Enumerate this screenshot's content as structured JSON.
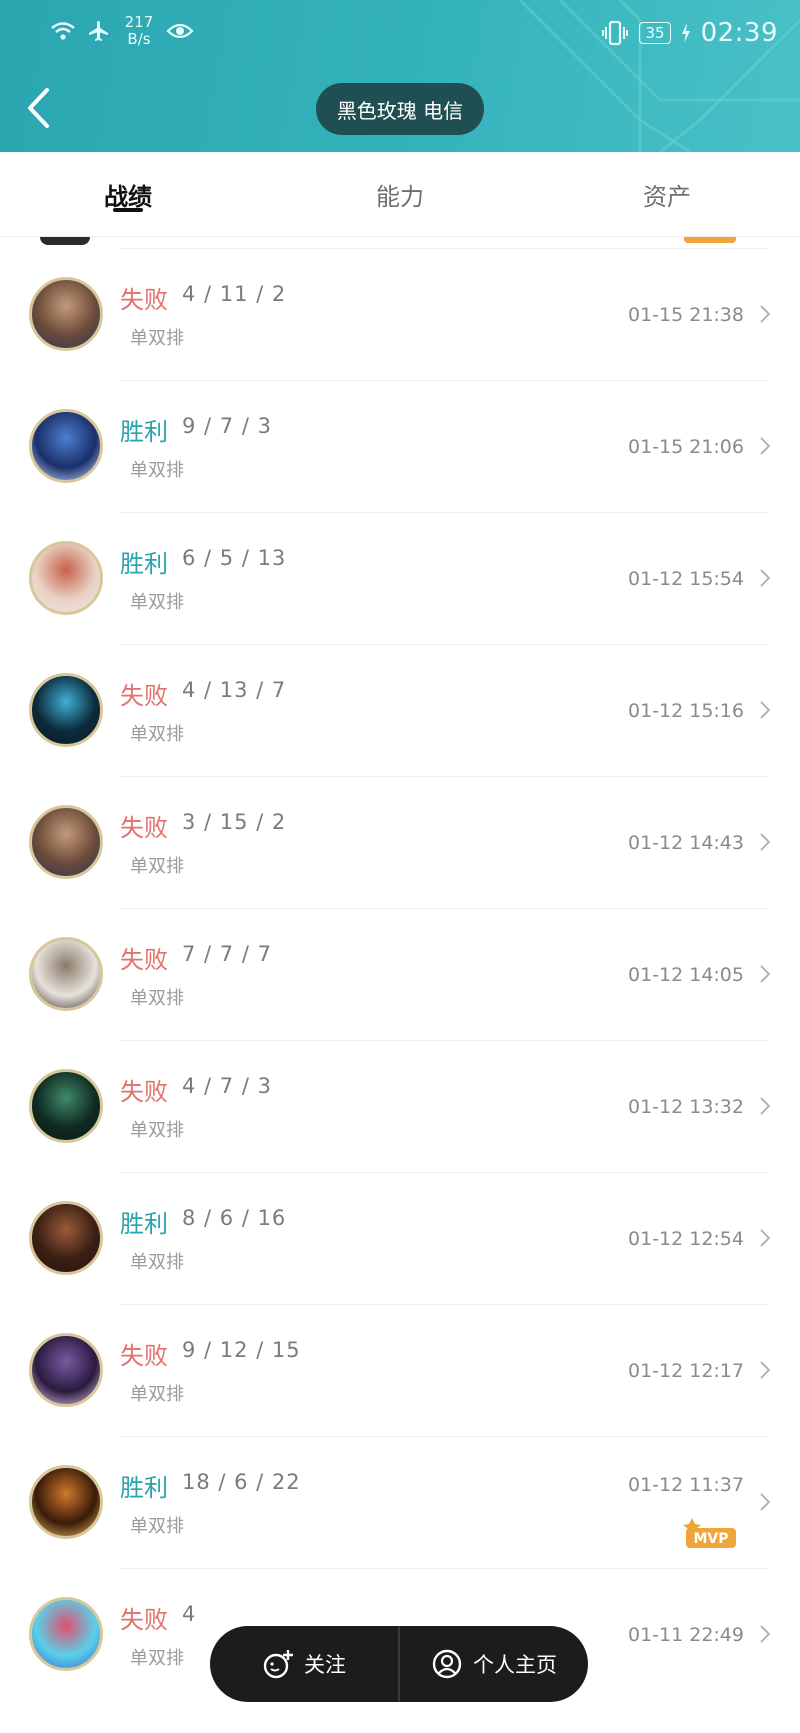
{
  "status_bar": {
    "speed_value": "217",
    "speed_unit": "B/s",
    "battery": "35",
    "time": "02:39"
  },
  "header": {
    "title": "黑色玫瑰 电信"
  },
  "tabs": [
    {
      "label": "战绩",
      "active": true
    },
    {
      "label": "能力",
      "active": false
    },
    {
      "label": "资产",
      "active": false
    }
  ],
  "matches": [
    {
      "result": "失败",
      "outcome": "lose",
      "kda": "4 / 11 / 2",
      "mode": "单双排",
      "time": "01-15 21:38",
      "mvp": false,
      "champion_icon": "champion-avatar-1"
    },
    {
      "result": "胜利",
      "outcome": "win",
      "kda": "9 / 7 / 3",
      "mode": "单双排",
      "time": "01-15 21:06",
      "mvp": false,
      "champion_icon": "champion-avatar-2"
    },
    {
      "result": "胜利",
      "outcome": "win",
      "kda": "6 / 5 / 13",
      "mode": "单双排",
      "time": "01-12 15:54",
      "mvp": false,
      "champion_icon": "champion-avatar-3"
    },
    {
      "result": "失败",
      "outcome": "lose",
      "kda": "4 / 13 / 7",
      "mode": "单双排",
      "time": "01-12 15:16",
      "mvp": false,
      "champion_icon": "champion-avatar-4"
    },
    {
      "result": "失败",
      "outcome": "lose",
      "kda": "3 / 15 / 2",
      "mode": "单双排",
      "time": "01-12 14:43",
      "mvp": false,
      "champion_icon": "champion-avatar-1"
    },
    {
      "result": "失败",
      "outcome": "lose",
      "kda": "7 / 7 / 7",
      "mode": "单双排",
      "time": "01-12 14:05",
      "mvp": false,
      "champion_icon": "champion-avatar-5"
    },
    {
      "result": "失败",
      "outcome": "lose",
      "kda": "4 / 7 / 3",
      "mode": "单双排",
      "time": "01-12 13:32",
      "mvp": false,
      "champion_icon": "champion-avatar-6"
    },
    {
      "result": "胜利",
      "outcome": "win",
      "kda": "8 / 6 / 16",
      "mode": "单双排",
      "time": "01-12 12:54",
      "mvp": false,
      "champion_icon": "champion-avatar-7"
    },
    {
      "result": "失败",
      "outcome": "lose",
      "kda": "9 / 12 / 15",
      "mode": "单双排",
      "time": "01-12 12:17",
      "mvp": false,
      "champion_icon": "champion-avatar-8"
    },
    {
      "result": "胜利",
      "outcome": "win",
      "kda": "18 / 6 / 22",
      "mode": "单双排",
      "time": "01-12 11:37",
      "mvp": true,
      "champion_icon": "champion-avatar-9"
    },
    {
      "result": "失败",
      "outcome": "lose",
      "kda": "4",
      "mode": "单双排",
      "time": "01-11 22:49",
      "mvp": false,
      "champion_icon": "champion-avatar-10"
    }
  ],
  "mvp_badge": "MVP",
  "bottom_bar": {
    "follow_label": "关注",
    "profile_label": "个人主页"
  },
  "colors": {
    "header": "#35b3bc",
    "win": "#2aa3ad",
    "lose": "#e0736e",
    "mvp": "#f0a53a"
  }
}
